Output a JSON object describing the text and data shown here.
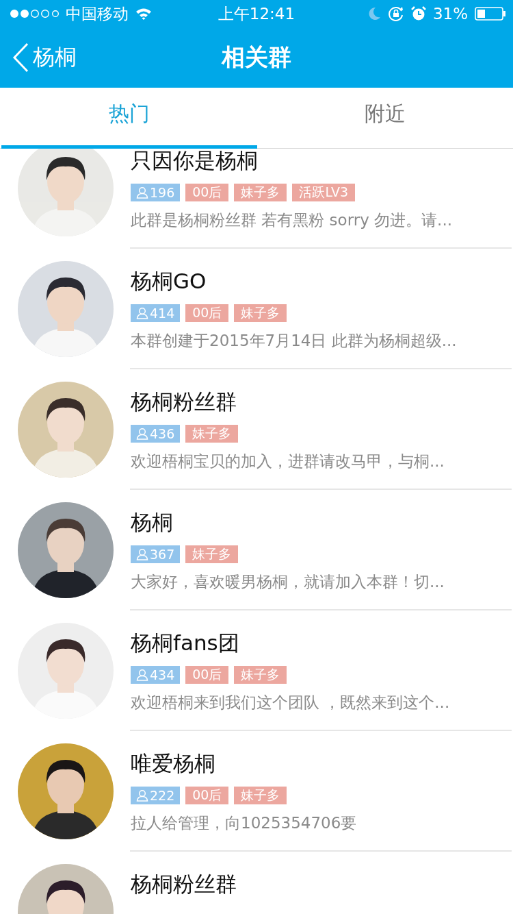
{
  "status_bar": {
    "carrier": "中国移动",
    "time": "上午12:41",
    "battery": "31%"
  },
  "nav": {
    "back": "杨桐",
    "title": "相关群"
  },
  "tabs": [
    {
      "label": "热门",
      "selected": true
    },
    {
      "label": "附近",
      "selected": false
    }
  ],
  "groups": [
    {
      "name": "只因你是杨桐",
      "members": "196",
      "tags": [
        "00后",
        "妹子多",
        "活跃LV3"
      ],
      "description": "此群是杨桐粉丝群 若有黑粉 sorry 勿进。请..."
    },
    {
      "name": "杨桐GO",
      "members": "414",
      "tags": [
        "00后",
        "妹子多"
      ],
      "description": "本群创建于2015年7月14日 此群为杨桐超级..."
    },
    {
      "name": "杨桐粉丝群",
      "members": "436",
      "tags": [
        "妹子多"
      ],
      "description": "欢迎梧桐宝贝的加入，进群请改马甲，与桐..."
    },
    {
      "name": "杨桐",
      "members": "367",
      "tags": [
        "妹子多"
      ],
      "description": "大家好，喜欢暖男杨桐，就请加入本群！切..."
    },
    {
      "name": "杨桐fans团",
      "members": "434",
      "tags": [
        "00后",
        "妹子多"
      ],
      "description": "欢迎梧桐来到我们这个团队 ，既然来到这个..."
    },
    {
      "name": "唯爱杨桐",
      "members": "222",
      "tags": [
        "00后",
        "妹子多"
      ],
      "description": "拉人给管理，向1025354706要"
    },
    {
      "name": "杨桐粉丝群"
    }
  ]
}
